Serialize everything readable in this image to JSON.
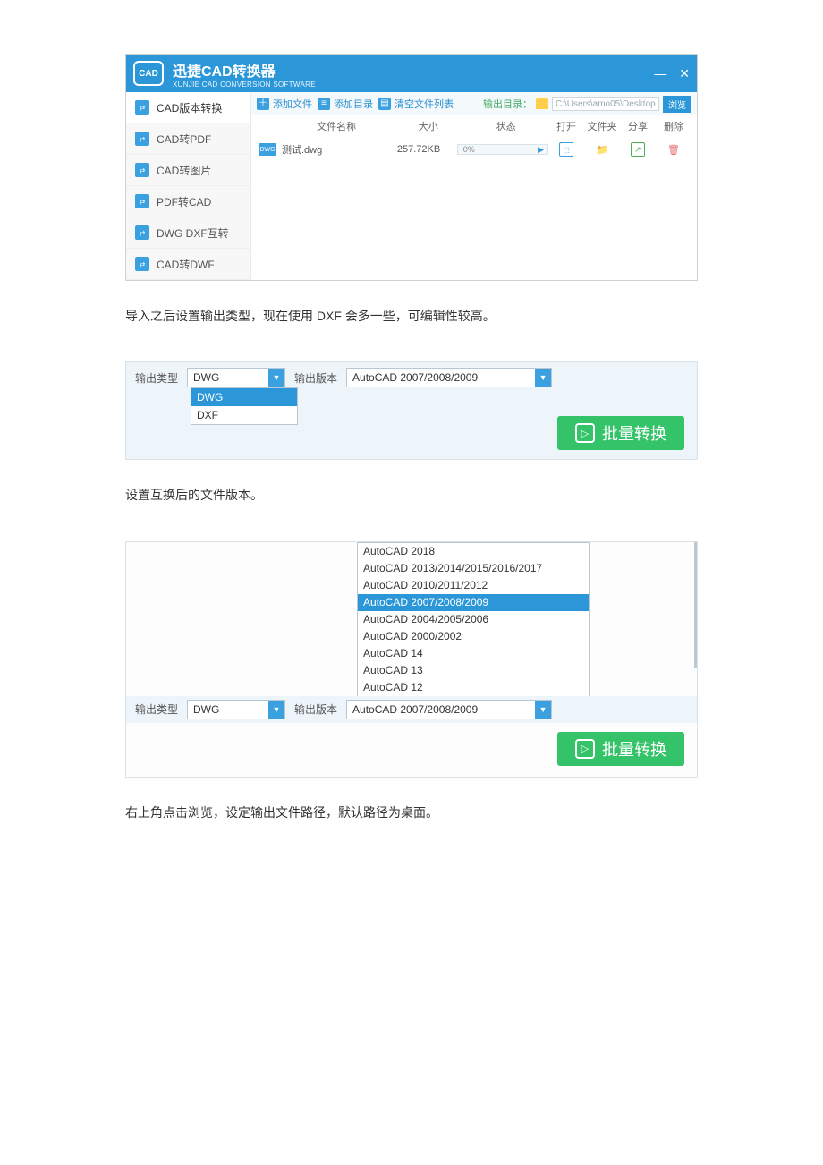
{
  "app": {
    "title": "迅捷CAD转换器",
    "subtitle": "XUNJIE CAD CONVERSION SOFTWARE",
    "logo_text": "CAD"
  },
  "sidebar": {
    "items": [
      {
        "label": "CAD版本转换"
      },
      {
        "label": "CAD转PDF"
      },
      {
        "label": "CAD转图片"
      },
      {
        "label": "PDF转CAD"
      },
      {
        "label": "DWG DXF互转"
      },
      {
        "label": "CAD转DWF"
      }
    ]
  },
  "toolbar": {
    "add_file": "添加文件",
    "add_dir": "添加目录",
    "clear": "清空文件列表",
    "output_dir_label": "输出目录：",
    "output_dir_value": "C:\\Users\\amo05\\Desktop",
    "browse": "浏览"
  },
  "table": {
    "col_name": "文件名称",
    "col_size": "大小",
    "col_status": "状态",
    "col_open": "打开",
    "col_folder": "文件夹",
    "col_share": "分享",
    "col_delete": "删除",
    "rows": [
      {
        "badge": "DWG",
        "name": "测试.dwg",
        "size": "257.72KB",
        "status": "0%"
      }
    ]
  },
  "prose1": "导入之后设置输出类型，现在使用 DXF 会多一些，可编辑性较高。",
  "panel1": {
    "type_label": "输出类型",
    "type_value": "DWG",
    "type_options": [
      "DWG",
      "DXF"
    ],
    "ver_label": "输出版本",
    "ver_value": "AutoCAD 2007/2008/2009",
    "button": "批量转换"
  },
  "prose2": "设置互换后的文件版本。",
  "panel2": {
    "type_label": "输出类型",
    "type_value": "DWG",
    "ver_label": "输出版本",
    "ver_value": "AutoCAD 2007/2008/2009",
    "ver_options": [
      "AutoCAD 2018",
      "AutoCAD 2013/2014/2015/2016/2017",
      "AutoCAD 2010/2011/2012",
      "AutoCAD 2007/2008/2009",
      "AutoCAD 2004/2005/2006",
      "AutoCAD 2000/2002",
      "AutoCAD 14",
      "AutoCAD 13",
      "AutoCAD 12"
    ],
    "ver_selected_index": 3,
    "button": "批量转换"
  },
  "prose3": "右上角点击浏览，设定输出文件路径，默认路径为桌面。"
}
